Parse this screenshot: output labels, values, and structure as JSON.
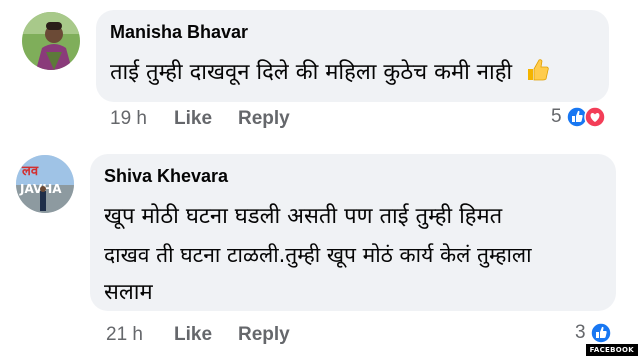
{
  "comments": [
    {
      "author": "Manisha Bhavar",
      "text_lines": [
        "ताई तुम्ही दाखवून दिले की महिला कुठेच कमी नाही"
      ],
      "emoji": "thumbs-up-emoji",
      "time": "19 h",
      "like_label": "Like",
      "reply_label": "Reply",
      "reaction_count": "5",
      "reactions": [
        "like-icon",
        "love-icon"
      ]
    },
    {
      "author": "Shiva Khevara",
      "avatar_text": "लव\nJAVHA",
      "text_lines": [
        "खूप मोठी घटना घडली असती पण ताई तुम्ही हिमत",
        "दाखव ती घटना टाळली.तुम्ही खूप मोठं कार्य केलं तुम्हाला",
        "सलाम"
      ],
      "time": "21 h",
      "like_label": "Like",
      "reply_label": "Reply",
      "reaction_count": "3",
      "reactions": [
        "like-icon"
      ]
    }
  ],
  "watermark": "FACEBOOK",
  "colors": {
    "bubble": "#f0f2f5",
    "meta_text": "#65676b",
    "like_blue": "#1877f2",
    "love_red": "#f33e58"
  }
}
